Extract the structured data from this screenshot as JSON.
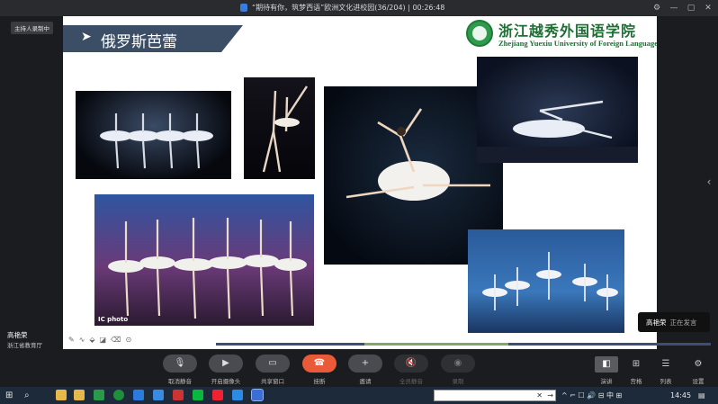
{
  "window": {
    "title": "“期待有你，筑梦西语”欧洲文化进校园(36/204)  |  00:26:48",
    "controls": [
      "⚙",
      "—",
      "▢",
      "✕"
    ]
  },
  "sidebar": {
    "host_tag": "主持人录制中",
    "speaker_name": "高艳荣",
    "speaker_org": "浙江省教育厅",
    "brand": "钉钉"
  },
  "slide": {
    "heading": "俄罗斯芭蕾",
    "heading_arrow": "➤",
    "logo_cn": "浙江越秀外国语学院",
    "logo_en": "Zhejiang Yuexiu University of Foreign Languages",
    "photo_badge": "IC photo",
    "colors": {
      "banner": "#3c4d66",
      "logo_green": "#1f6e35"
    }
  },
  "annotation_tools": [
    "✎",
    "∿",
    "⬙",
    "◪",
    "⌫",
    "⊙"
  ],
  "progress": {
    "colors": [
      "#3d4f72",
      "#7fa86b",
      "#3d4f72"
    ]
  },
  "speaking_toast": {
    "name": "高艳荣",
    "status": "正在发言"
  },
  "side_arrow": "‹",
  "controls": [
    {
      "icon": "🎙",
      "label": "取消静音",
      "enabled": true
    },
    {
      "icon": "▶",
      "label": "开启摄像头",
      "enabled": true
    },
    {
      "icon": "▭",
      "label": "共享窗口",
      "enabled": true
    },
    {
      "icon": "☎",
      "label": "挂断",
      "enabled": true,
      "accent": "#ea5a38"
    },
    {
      "icon": "+",
      "label": "邀请",
      "enabled": true
    },
    {
      "icon": "🔇",
      "label": "全员静音",
      "enabled": false
    },
    {
      "icon": "◉",
      "label": "录制",
      "enabled": false
    }
  ],
  "view_modes": [
    {
      "icon": "◧",
      "label": "演讲",
      "active": true
    },
    {
      "icon": "⊞",
      "label": "宫格",
      "active": false
    },
    {
      "icon": "☰",
      "label": "列表",
      "active": false
    },
    {
      "icon": "⚙",
      "label": "设置",
      "active": false
    }
  ],
  "taskbar": {
    "start": "⊞",
    "search_glyph": "⌕",
    "search_clear": "✕",
    "search_go": "→",
    "tray_text": "^ ⌐ ☐ 🔊 ⊟ 中 ⊞",
    "time": "14:45",
    "notify": "▤"
  }
}
